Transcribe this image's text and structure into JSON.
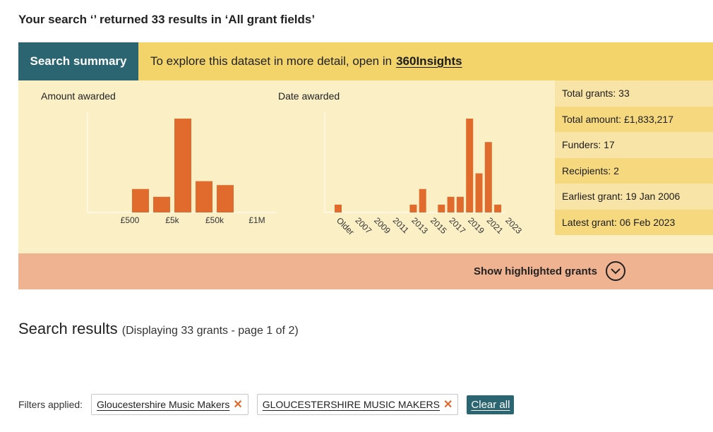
{
  "page": {
    "heading": "Your search ‘’ returned 33 results in ‘All grant fields’"
  },
  "summary": {
    "tab_label": "Search summary",
    "banner_text": "To explore this dataset in more detail, open in",
    "banner_link": "360Insights",
    "stats": [
      "Total grants: 33",
      "Total amount: £1,833,217",
      "Funders: 17",
      "Recipients: 2",
      "Earliest grant: 19 Jan 2006",
      "Latest grant: 06 Feb 2023"
    ],
    "show_highlighted": "Show highlighted grants"
  },
  "chart_data": [
    {
      "type": "bar",
      "title": "Amount awarded",
      "categories": [
        "1",
        "2",
        "3",
        "4",
        "5",
        "6",
        "7",
        "8",
        "9"
      ],
      "values": [
        0,
        0,
        3,
        2,
        12,
        4,
        3.5,
        0,
        0
      ],
      "tick_labels": [
        {
          "after_bar": 1,
          "label": "£500"
        },
        {
          "after_bar": 3,
          "label": "£5k"
        },
        {
          "after_bar": 5,
          "label": "£50k"
        },
        {
          "after_bar": 7,
          "label": "£1M"
        }
      ],
      "ylim": [
        0,
        12
      ]
    },
    {
      "type": "bar",
      "title": "Date awarded",
      "categories": [
        "Older",
        "2006",
        "2007",
        "2008",
        "2009",
        "2010",
        "2011",
        "2012",
        "2013",
        "2014",
        "2015",
        "2016",
        "2017",
        "2018",
        "2019",
        "2020",
        "2021",
        "2022",
        "2023"
      ],
      "values": [
        1,
        0,
        0,
        0,
        0,
        0,
        0,
        0,
        1,
        3,
        0,
        1,
        2,
        2,
        12,
        5,
        9,
        1,
        0
      ],
      "tick_labels": [
        "Older",
        "2007",
        "2009",
        "2011",
        "2013",
        "2015",
        "2017",
        "2019",
        "2021",
        "2023"
      ],
      "ylim": [
        0,
        12
      ]
    }
  ],
  "results": {
    "title": "Search results",
    "subtitle": "(Displaying 33 grants - page 1 of 2)"
  },
  "filters": {
    "label": "Filters applied:",
    "chips": [
      "Gloucestershire Music Makers",
      "GLOUCESTERSHIRE MUSIC MAKERS"
    ],
    "remove_glyph": "✕",
    "clear_label": "Clear all"
  },
  "colors": {
    "bar": "#e06b2c",
    "accent_teal": "#2a6571",
    "banner_yellow": "#f3d46a",
    "panel_cream": "#fbefc6",
    "highlight_salmon": "#efb391"
  },
  "icons": {
    "show_highlighted": "chevron-down-circle-icon",
    "remove_filter": "close-icon"
  }
}
